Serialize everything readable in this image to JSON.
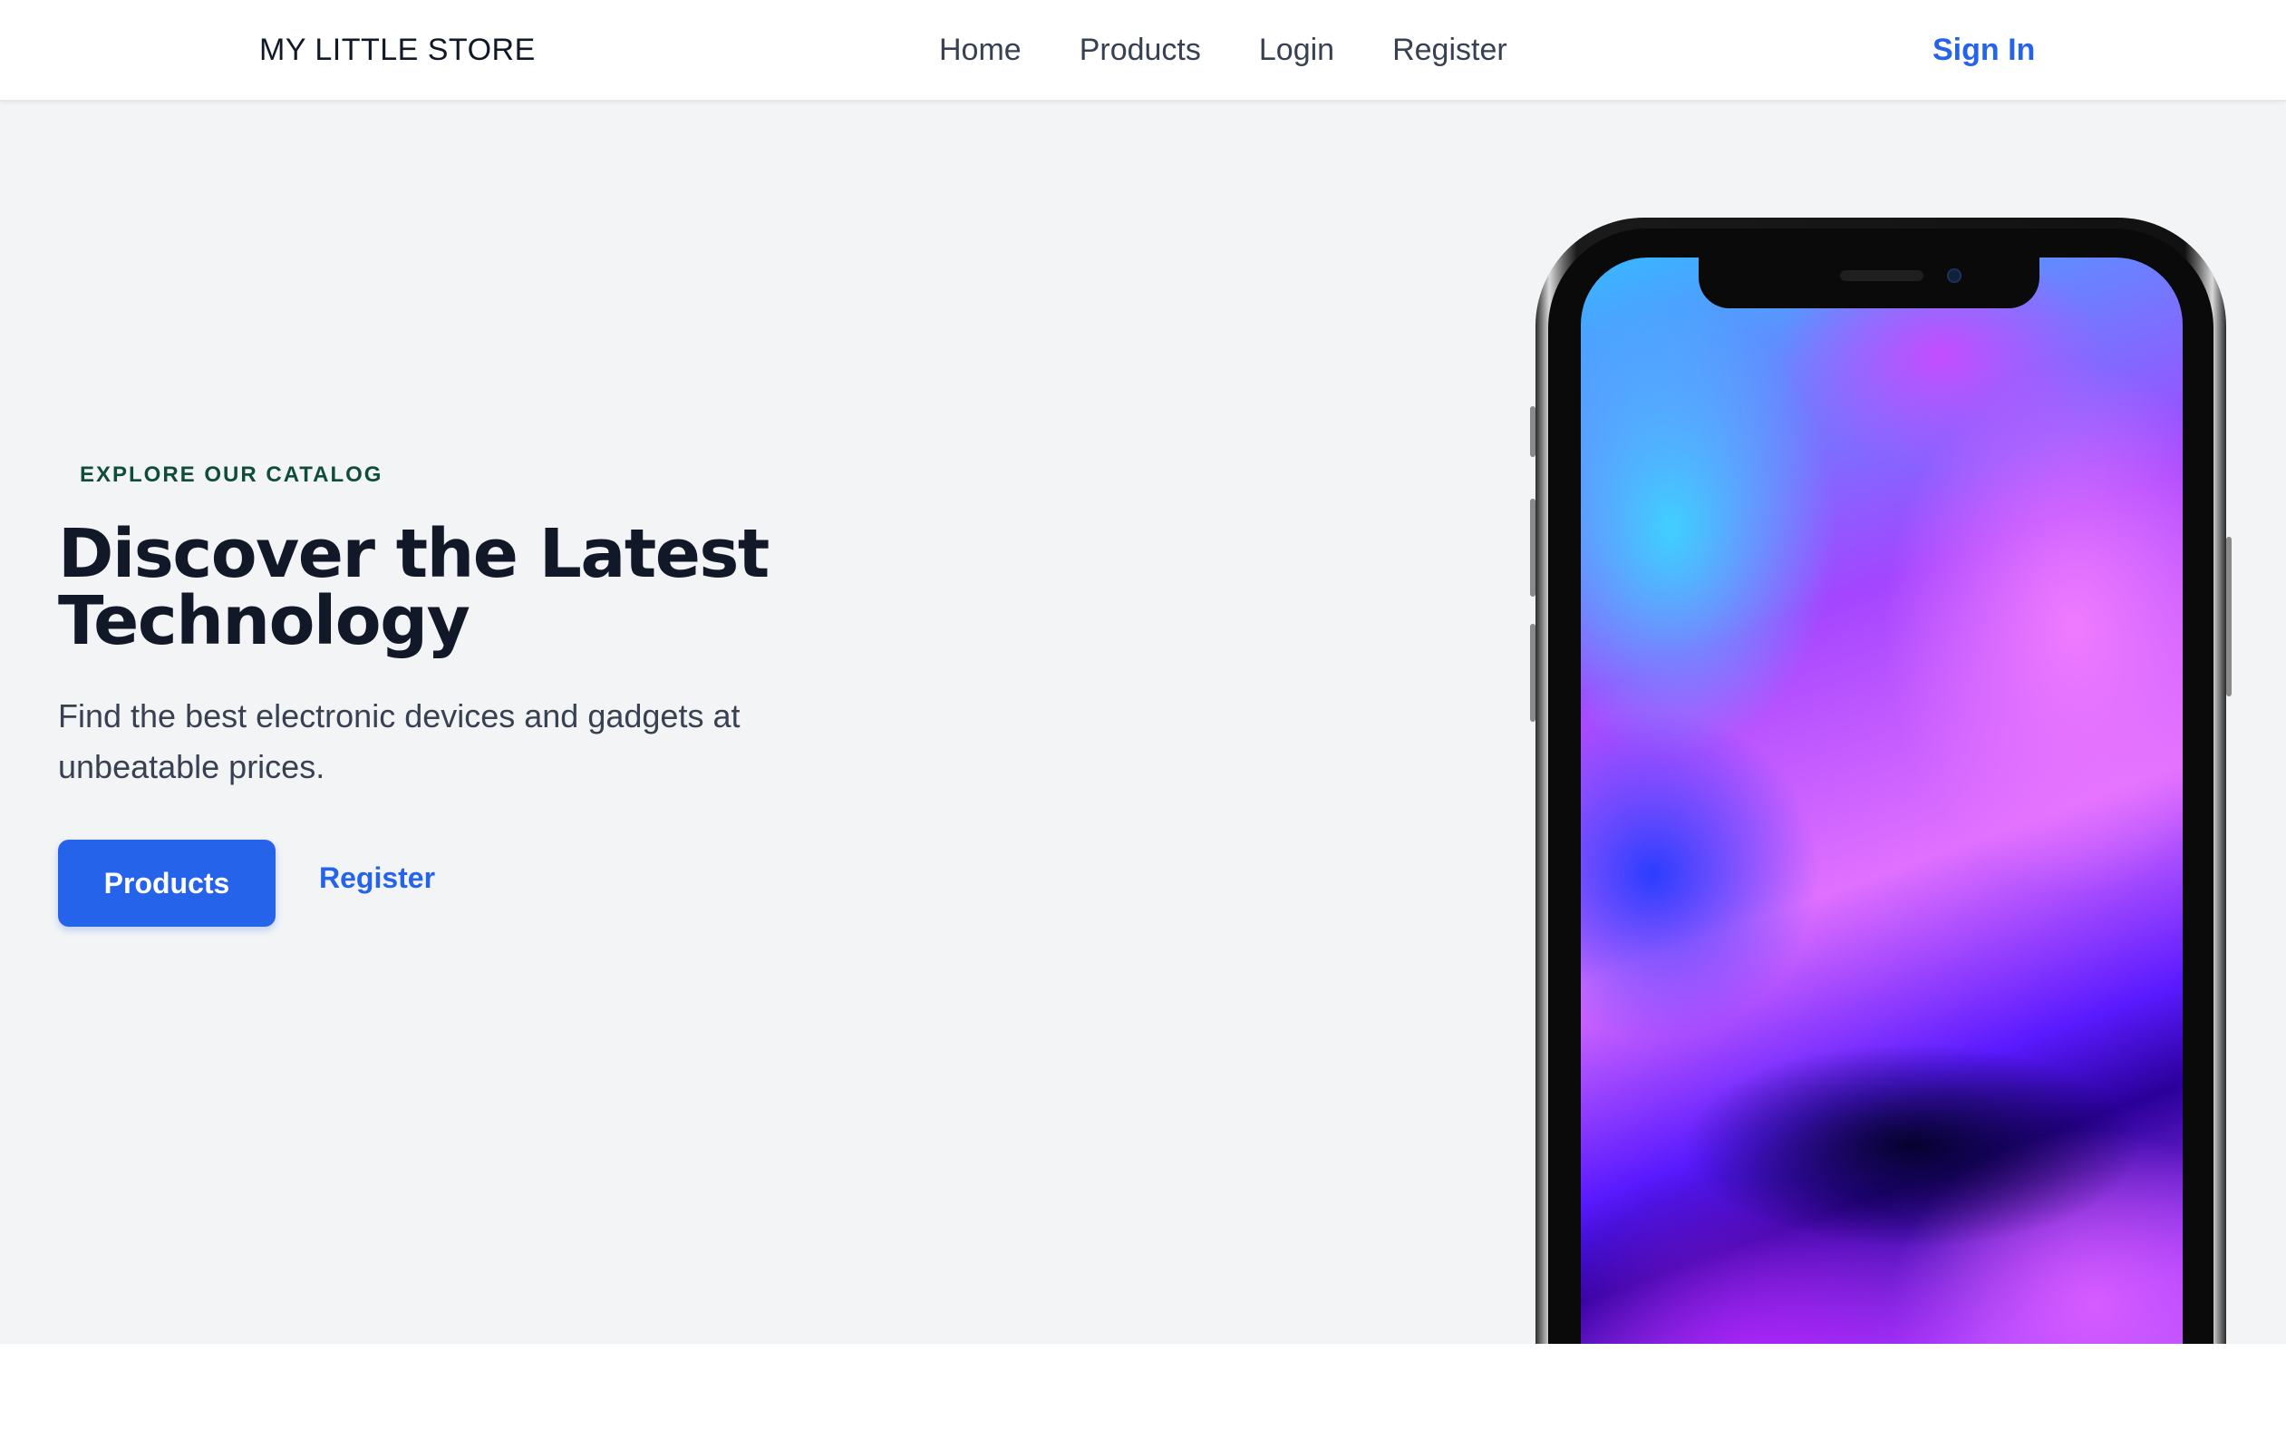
{
  "header": {
    "brand": "MY LITTLE STORE",
    "nav": [
      {
        "label": "Home"
      },
      {
        "label": "Products"
      },
      {
        "label": "Login"
      },
      {
        "label": "Register"
      }
    ],
    "signin_label": "Sign In"
  },
  "hero": {
    "eyebrow": "EXPLORE OUR CATALOG",
    "headline": "Discover the Latest Technology",
    "subtext": "Find the best electronic devices and gadgets at unbeatable prices.",
    "primary_button": "Products",
    "secondary_link": "Register"
  },
  "colors": {
    "accent": "#2563eb",
    "eyebrow": "#0f4c3a",
    "hero_bg": "#f3f4f6",
    "heading": "#111827"
  }
}
